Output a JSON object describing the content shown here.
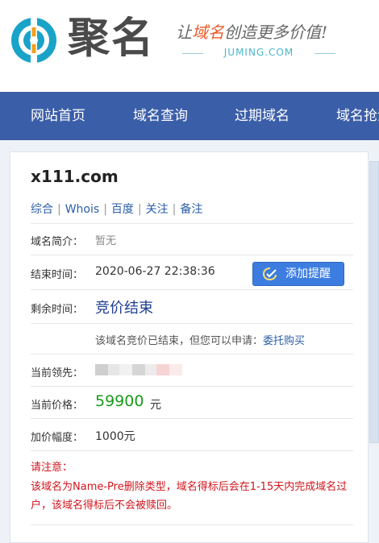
{
  "header": {
    "logo_text": "聚名",
    "slogan_prefix": "让",
    "slogan_highlight": "域名",
    "slogan_suffix": "创造更多价值!",
    "slogan_sub": "JUMING.COM"
  },
  "nav": {
    "items": [
      "网站首页",
      "域名查询",
      "过期域名",
      "域名抢注"
    ]
  },
  "domain": {
    "name": "x111.com",
    "links": [
      "综合",
      "Whois",
      "百度",
      "关注",
      "备注"
    ]
  },
  "details": {
    "intro_label": "域名简介：",
    "intro_value": "暂无",
    "end_label": "结束时间：",
    "end_value": "2020-06-27 22:38:36",
    "remind_button": "添加提醒",
    "remaining_label": "剩余时间：",
    "remaining_value": "竞价结束",
    "ended_note": "该域名竞价已结束，但您可以申请：",
    "entrust_link": "委托购买",
    "leader_label": "当前领先：",
    "price_label": "当前价格：",
    "price_value": "59900",
    "price_unit": "元",
    "increment_label": "加价幅度：",
    "increment_value": "1000元"
  },
  "notice": {
    "title": "请注意：",
    "text": "该域名为Name-Pre删除类型，域名得标后会在1-15天内完成域名过户，该域名得标后不会被赎回。"
  },
  "colors": {
    "nav_bg": "#3b5ea8",
    "link": "#2b5ea8",
    "price": "#1a9a1a",
    "notice": "#d0161e",
    "button": "#3d7de0"
  }
}
